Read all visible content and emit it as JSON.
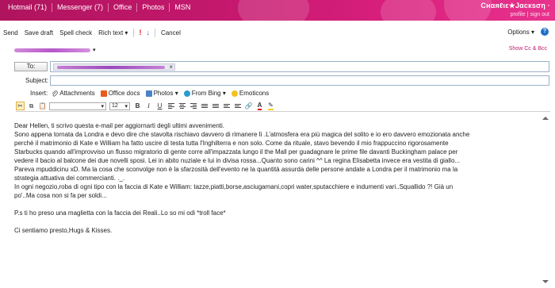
{
  "topnav": {
    "items": [
      "Hotmail (71)",
      "Messenger (7)",
      "Office",
      "Photos",
      "MSN"
    ]
  },
  "user": {
    "name": "Cнαяℓιε★Jαcкѕση ·",
    "profile_link": "profile",
    "signout_link": "sign out"
  },
  "toolbar": {
    "send": "Send",
    "save_draft": "Save draft",
    "spell_check": "Spell check",
    "rich_text": "Rich text ▾",
    "priority_high": "!",
    "priority_low": "↓",
    "cancel": "Cancel",
    "options": "Options ▾",
    "help": "?"
  },
  "compose": {
    "show_cc_bcc": "Show Cc & Bcc",
    "to_label": "To:",
    "subject_label": "Subject:",
    "to_remove": "×"
  },
  "insert": {
    "label": "Insert:",
    "items": [
      "Attachments",
      "Office docs",
      "Photos ▾",
      "From Bing ▾",
      "Emoticons"
    ]
  },
  "format": {
    "font_size": "12"
  },
  "message": {
    "lines": [
      "Dear Hellen, ti scrivo questa e-mail per aggiornarti degli ultimi avvenimenti.",
      "Sono appena tornata da Londra e devo dire che stavolta rischiavo davvero di rimanere lì .L'atmosfera era più magica del solito e io ero davvero emozionata anche",
      "perchè  il matrimonio di Kate e William ha fatto uscire di testa tutta l'Inghilterra e non solo. Come da rituale, stavo bevendo il mio frappuccino rigorosamente",
      "Starbucks quando all'improvviso un flusso migratorio di gente corre all'impazzata lungo il the Mall per guadagnare le prime file davanti Buckingham palace per",
      "vedere il bacio al balcone dei due novelli sposi. Lei in abito nuziale e lui in divisa rossa...Quanto sono carini ^^ La regina Elisabetta invece era vestita di giallo...",
      "Pareva mpuddicinu xD. Ma la cosa che sconvolge non è la sfarzosità dell'evento ne la quantità assurda delle persone andate a Londra per il matrimonio ma la",
      "strategia attuativa dei commercianti. ._.",
      "In ogni negozio,roba di ogni tipo con la faccia di Kate e William: tazze,piatti,borse,asciugamani,copri water,sputacchiere e indumenti vari..Squallido ?! Già un",
      "po'..Ma cosa non si fa per soldi..."
    ],
    "ps": "P.s ti ho preso una maglietta con la faccia dei Reali..Lo so mi odi *troll face*",
    "closing": "Ci sentiamo presto,Hugs & Kisses."
  }
}
